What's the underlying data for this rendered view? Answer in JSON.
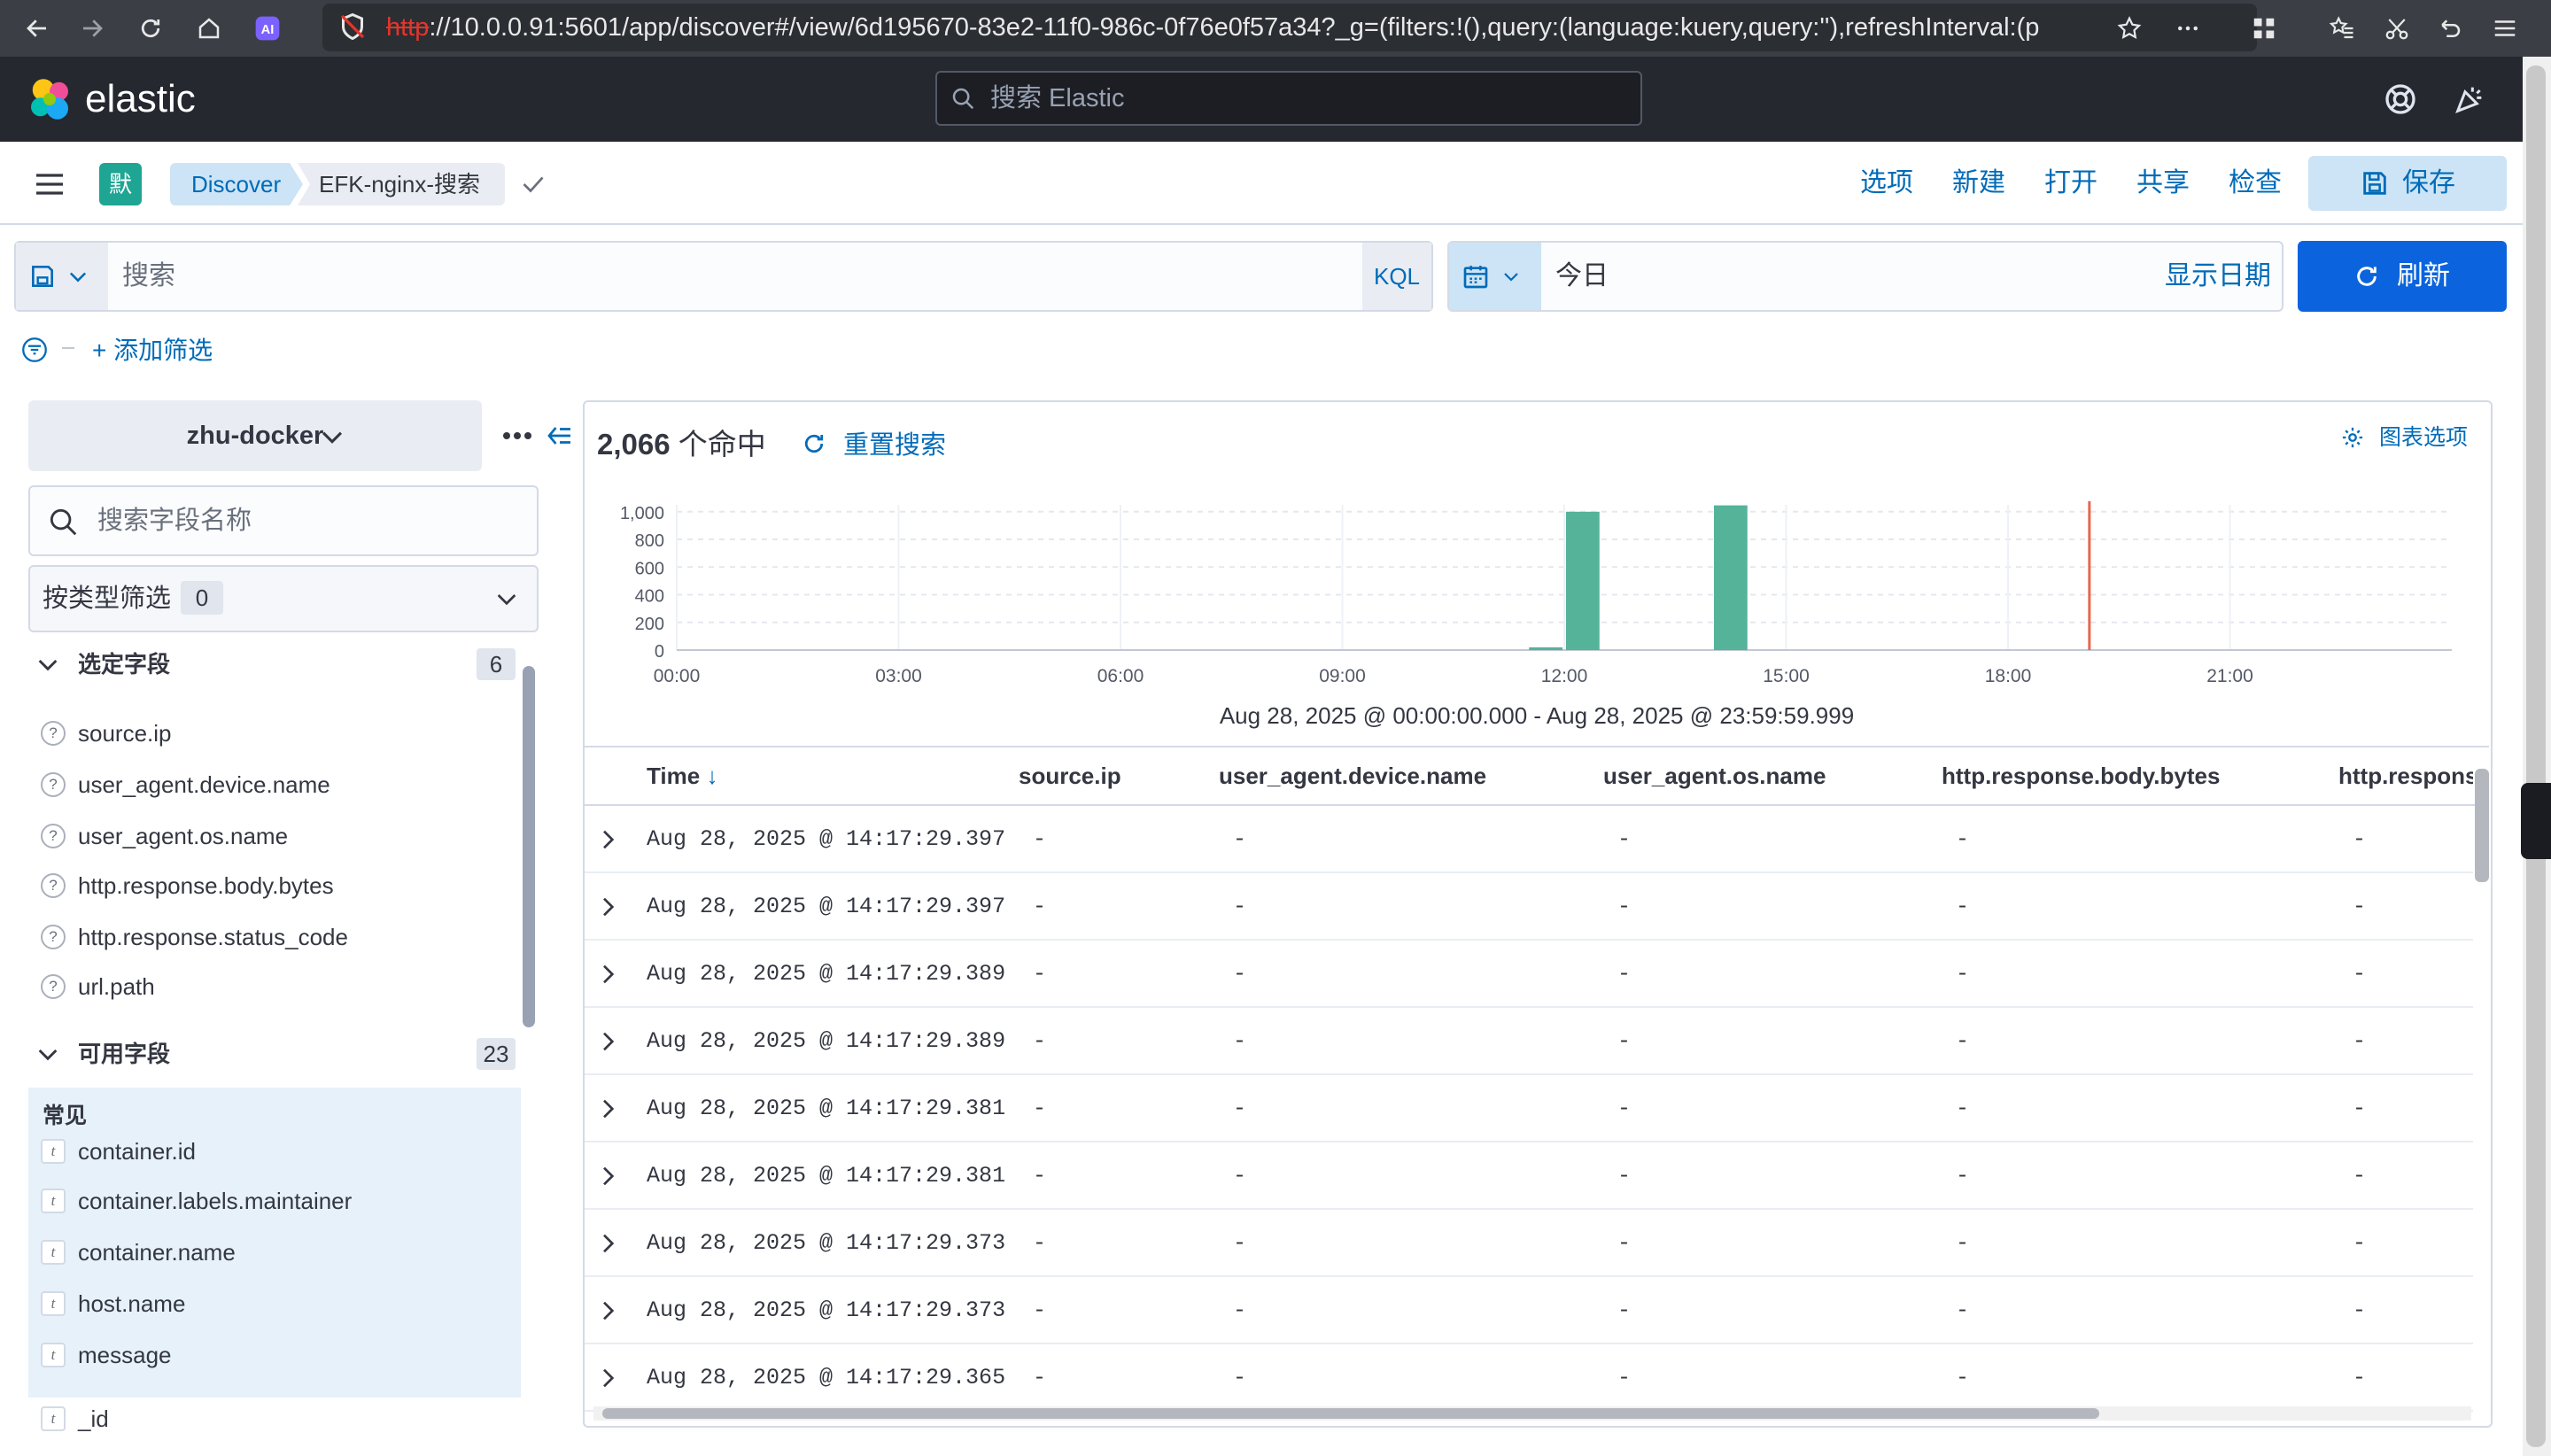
{
  "browser": {
    "url_scheme": "http",
    "url_rest": "://10.0.0.91:5601/app/discover#/view/6d195670-83e2-11f0-986c-0f76e0f57a34?_g=(filters:!(),query:(language:kuery,query:''),refreshInterval:(p"
  },
  "header": {
    "logo": "elastic",
    "search_placeholder": "搜索 Elastic"
  },
  "app_bar": {
    "space_initial": "默",
    "breadcrumbs": [
      "Discover",
      "EFK-nginx-搜索"
    ],
    "nav": [
      "选项",
      "新建",
      "打开",
      "共享",
      "检查"
    ],
    "save_label": "保存"
  },
  "query_bar": {
    "placeholder": "搜索",
    "language": "KQL",
    "date_value": "今日",
    "show_dates": "显示日期",
    "refresh_label": "刷新"
  },
  "filters": {
    "add_label": "+ 添加筛选"
  },
  "sidebar": {
    "index_pattern": "zhu-docker",
    "field_search_placeholder": "搜索字段名称",
    "type_filter_label": "按类型筛选",
    "type_filter_count": "0",
    "selected_title": "选定字段",
    "selected_count": "6",
    "selected_fields": [
      "source.ip",
      "user_agent.device.name",
      "user_agent.os.name",
      "http.response.body.bytes",
      "http.response.status_code",
      "url.path"
    ],
    "available_title": "可用字段",
    "available_count": "23",
    "common_label": "常见",
    "common_fields": [
      "container.id",
      "container.labels.maintainer",
      "container.name",
      "host.name",
      "message"
    ],
    "other_fields": [
      "_id"
    ]
  },
  "main": {
    "hits_number": "2,066",
    "hits_suffix": " 个命中",
    "reset_search": "重置搜索",
    "chart_options": "图表选项",
    "time_range": "Aug 28, 2025 @ 00:00:00.000 - Aug 28, 2025 @ 23:59:59.999"
  },
  "chart_data": {
    "type": "bar",
    "x": [
      "00:00",
      "03:00",
      "06:00",
      "09:00",
      "12:00",
      "15:00",
      "18:00",
      "21:00"
    ],
    "x_ticks_hours": [
      0,
      3,
      6,
      9,
      12,
      15,
      18,
      21
    ],
    "y_ticks": [
      0,
      200,
      400,
      600,
      800,
      1000
    ],
    "y_tick_labels": [
      "0",
      "200",
      "400",
      "600",
      "800",
      "1,000"
    ],
    "xlim_hours": [
      0,
      24
    ],
    "ylim": [
      0,
      1050
    ],
    "bars": [
      {
        "start_hour": 11.5,
        "end_hour": 12.0,
        "value": 20
      },
      {
        "start_hour": 12.0,
        "end_hour": 12.5,
        "value": 1000
      },
      {
        "start_hour": 14.0,
        "end_hour": 14.5,
        "value": 1046
      }
    ],
    "now_marker_hour": 19.1,
    "bar_color": "#54b399",
    "marker_color": "#e7664c",
    "grid": true
  },
  "table": {
    "columns": [
      "Time",
      "source.ip",
      "user_agent.device.name",
      "user_agent.os.name",
      "http.response.body.bytes",
      "http.respons"
    ],
    "rows": [
      [
        "Aug 28, 2025 @ 14:17:29.397",
        "-",
        "-",
        "-",
        "-",
        "-"
      ],
      [
        "Aug 28, 2025 @ 14:17:29.397",
        "-",
        "-",
        "-",
        "-",
        "-"
      ],
      [
        "Aug 28, 2025 @ 14:17:29.389",
        "-",
        "-",
        "-",
        "-",
        "-"
      ],
      [
        "Aug 28, 2025 @ 14:17:29.389",
        "-",
        "-",
        "-",
        "-",
        "-"
      ],
      [
        "Aug 28, 2025 @ 14:17:29.381",
        "-",
        "-",
        "-",
        "-",
        "-"
      ],
      [
        "Aug 28, 2025 @ 14:17:29.381",
        "-",
        "-",
        "-",
        "-",
        "-"
      ],
      [
        "Aug 28, 2025 @ 14:17:29.373",
        "-",
        "-",
        "-",
        "-",
        "-"
      ],
      [
        "Aug 28, 2025 @ 14:17:29.373",
        "-",
        "-",
        "-",
        "-",
        "-"
      ],
      [
        "Aug 28, 2025 @ 14:17:29.365",
        "-",
        "-",
        "-",
        "-",
        "-"
      ]
    ]
  }
}
